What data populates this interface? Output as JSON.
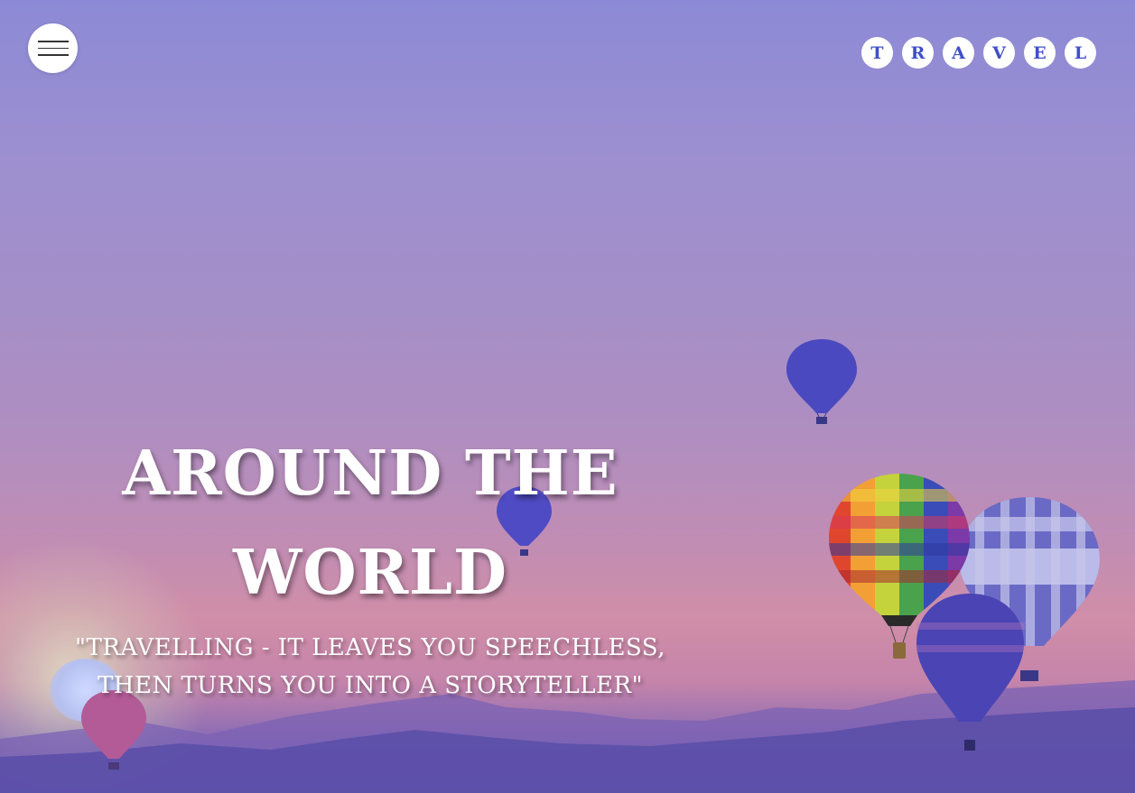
{
  "header": {
    "logo_letters": [
      "T",
      "R",
      "A",
      "V",
      "E",
      "L"
    ],
    "menu_icon": "hamburger-menu-icon"
  },
  "hero": {
    "headline_line1": "AROUND THE",
    "headline_line2": "WORLD",
    "quote_line1": "\"TRAVELLING - IT LEAVES YOU SPEECHLESS,",
    "quote_line2": "THEN TURNS YOU INTO A STORYTELLER\""
  },
  "colors": {
    "accent": "#3f4fc8",
    "sky_top": "#8c8ad6",
    "sky_bottom": "#5c54a8",
    "balloon_blue": "#4c4cbe"
  }
}
